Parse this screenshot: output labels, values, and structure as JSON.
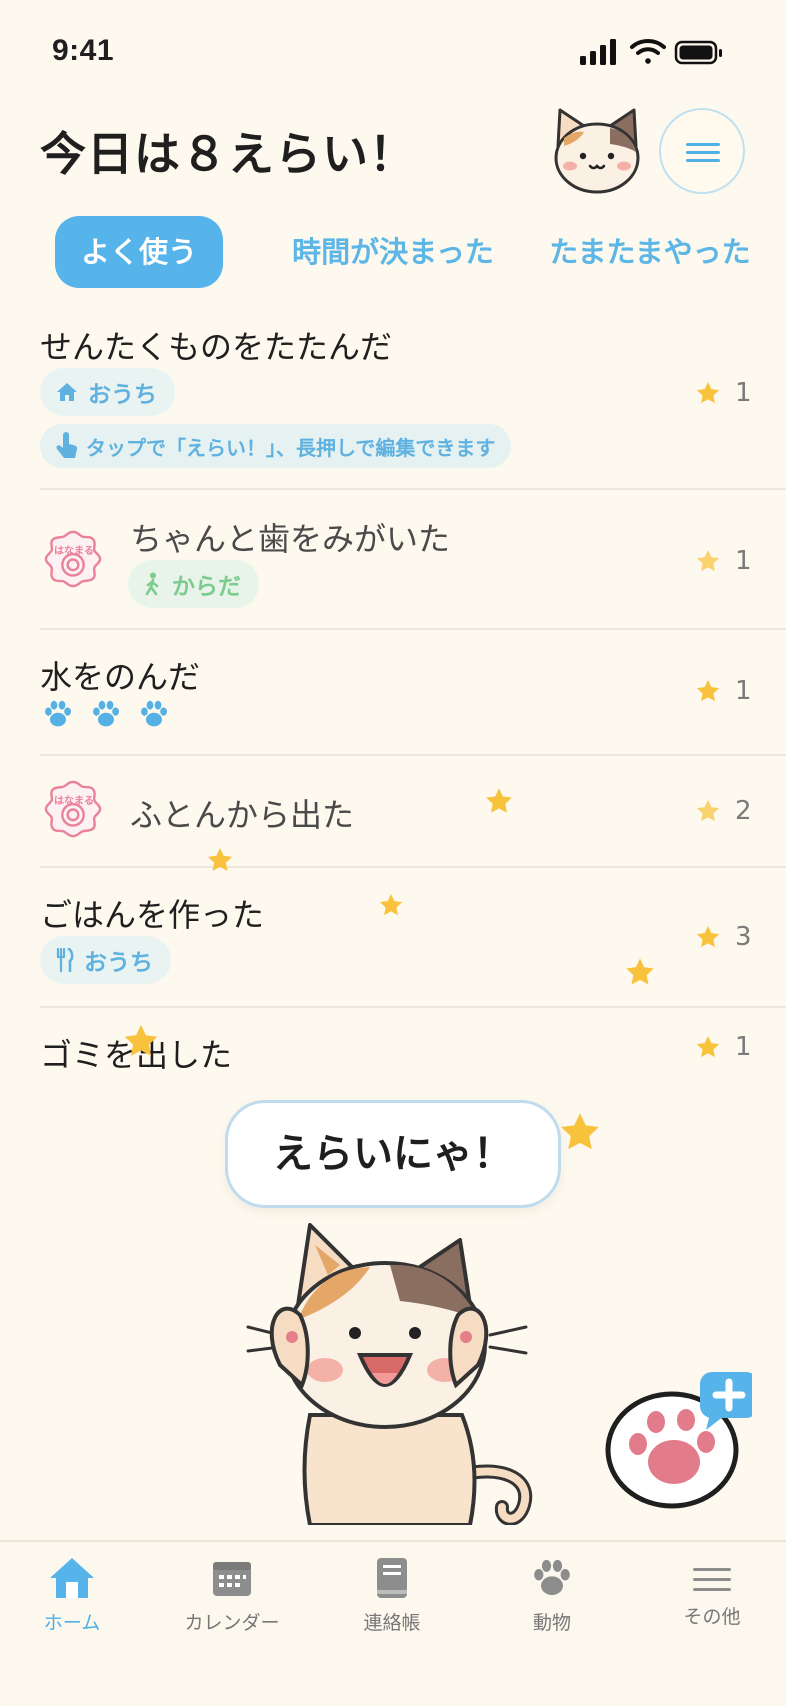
{
  "status_bar": {
    "time": "9:41"
  },
  "header": {
    "title": "今日は８えらい！"
  },
  "tabs": [
    {
      "label": "よく使う",
      "active": true
    },
    {
      "label": "時間が決まった",
      "active": false
    },
    {
      "label": "たまたまやった",
      "active": false
    }
  ],
  "items": [
    {
      "title": "せんたくものをたたんだ",
      "chip": "おうち",
      "chip_icon": "house-icon",
      "hint": "タップで「えらい！」、長押しで編集できます",
      "count": "1",
      "stamp": false
    },
    {
      "title": "ちゃんと歯をみがいた",
      "chip": "からだ",
      "chip_icon": "walking-person-icon",
      "count": "1",
      "stamp": true,
      "stamp_text": "はなまる"
    },
    {
      "title": "水をのんだ",
      "paw_count": 3,
      "count": "1",
      "stamp": false
    },
    {
      "title": "ふとんから出た",
      "count": "2",
      "stamp": true,
      "stamp_text": "はなまる"
    },
    {
      "title": "ごはんを作った",
      "chip": "おうち",
      "chip_icon": "fork-knife-icon",
      "count": "3",
      "stamp": false
    },
    {
      "title": "ゴミを出した",
      "count": "1",
      "stamp": false
    }
  ],
  "bubble": {
    "text": "えらいにゃ！"
  },
  "nav": [
    {
      "label": "ホーム",
      "icon": "home-icon",
      "active": true
    },
    {
      "label": "カレンダー",
      "icon": "calendar-icon",
      "active": false
    },
    {
      "label": "連絡帳",
      "icon": "notebook-icon",
      "active": false
    },
    {
      "label": "動物",
      "icon": "paw-icon",
      "active": false
    },
    {
      "label": "その他",
      "icon": "menu-icon",
      "active": false
    }
  ],
  "colors": {
    "background": "#fef9ee",
    "accent": "#56b4ea",
    "star": "#f9c23c",
    "stamp": "#e9829a"
  }
}
